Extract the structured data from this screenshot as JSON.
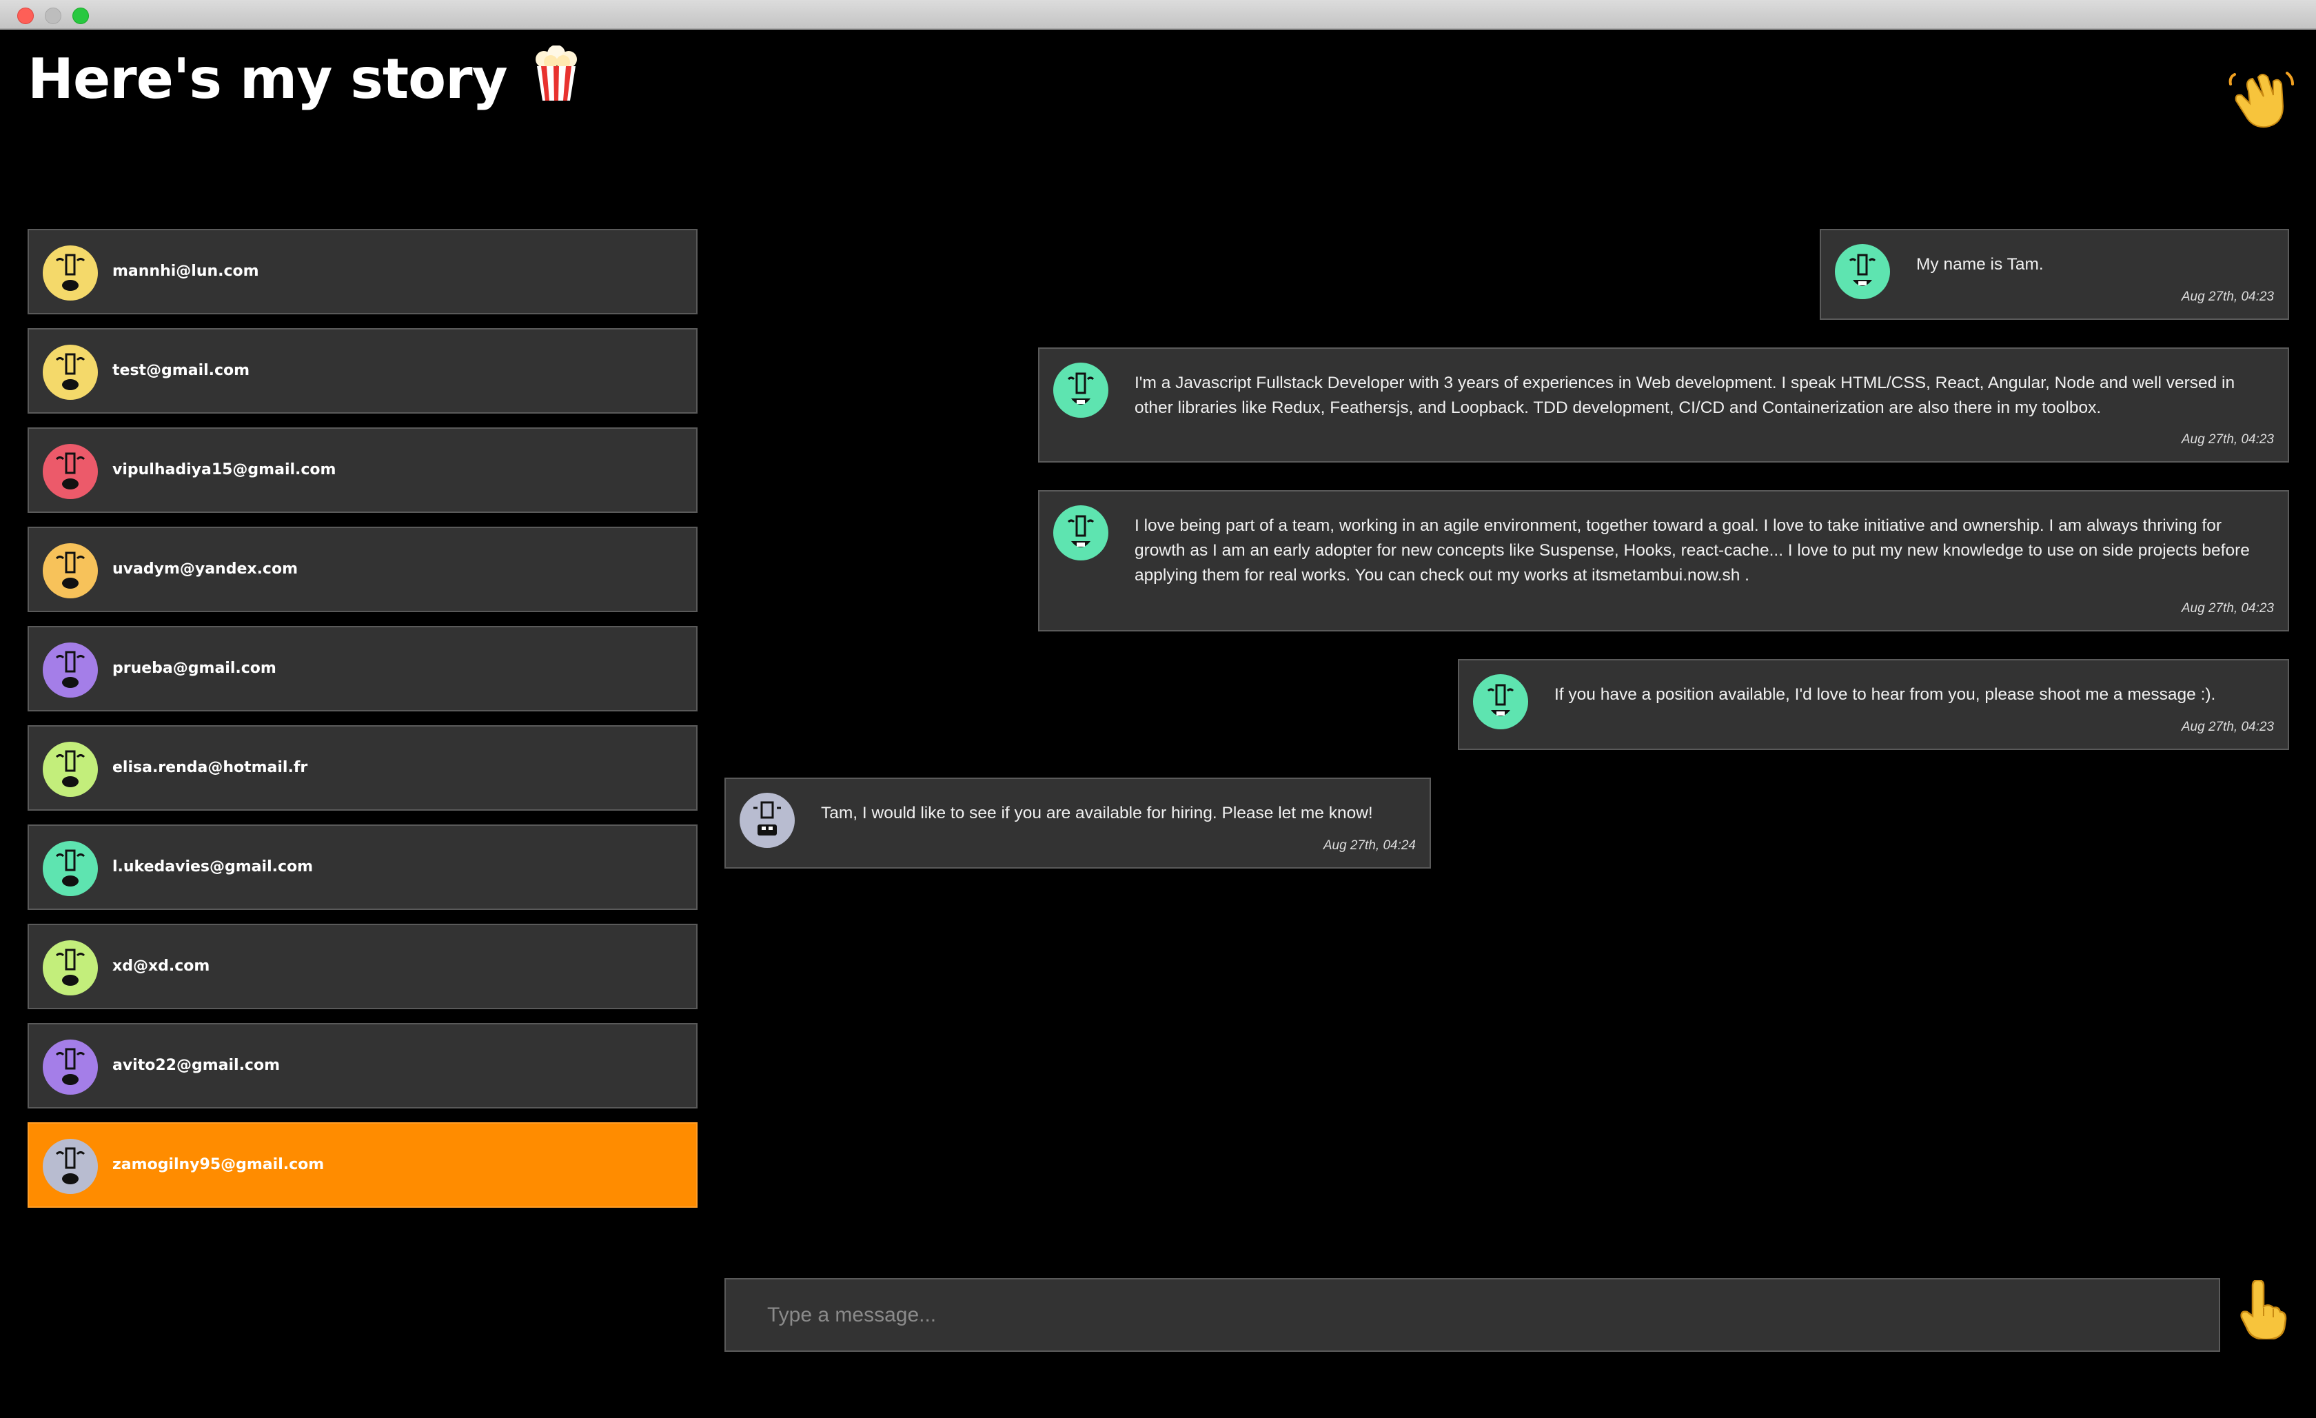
{
  "window": {
    "title": ""
  },
  "header": {
    "title": "Here's my story",
    "title_emoji": "popcorn-icon",
    "wave_button": "waving-hand-icon"
  },
  "contacts": [
    {
      "email": "mannhi@lun.com",
      "avatar_color": "#f4d96a",
      "active": false
    },
    {
      "email": "test@gmail.com",
      "avatar_color": "#f4d96a",
      "active": false
    },
    {
      "email": "vipulhadiya15@gmail.com",
      "avatar_color": "#ec5a6a",
      "active": false
    },
    {
      "email": "uvadym@yandex.com",
      "avatar_color": "#f7c25a",
      "active": false
    },
    {
      "email": "prueba@gmail.com",
      "avatar_color": "#a47ee8",
      "active": false
    },
    {
      "email": "elisa.renda@hotmail.fr",
      "avatar_color": "#c3ee7b",
      "active": false
    },
    {
      "email": "l.ukedavies@gmail.com",
      "avatar_color": "#5ee4b0",
      "active": false
    },
    {
      "email": "xd@xd.com",
      "avatar_color": "#c3ee7b",
      "active": false
    },
    {
      "email": "avito22@gmail.com",
      "avatar_color": "#a47ee8",
      "active": false
    },
    {
      "email": "zamogilny95@gmail.com",
      "avatar_color": "#b8bcd0",
      "active": true
    }
  ],
  "messages": [
    {
      "text": "My name is Tam.",
      "time": "Aug 27th, 04:23",
      "avatar_color": "#5ee4b0"
    },
    {
      "text": "I'm a Javascript Fullstack Developer with 3 years of experiences in Web development. I speak HTML/CSS, React, Angular, Node and well versed in other libraries like Redux, Feathersjs, and Loopback. TDD development, CI/CD and Containerization are also there in my toolbox.",
      "time": "Aug 27th, 04:23",
      "avatar_color": "#5ee4b0"
    },
    {
      "text": "I love being part of a team, working in an agile environment, together toward a goal. I love to take initiative and ownership. I am always thriving for growth as I am an early adopter for new concepts like Suspense, Hooks, react-cache... I love to put my new knowledge to use on side projects before applying them for real works. You can check out my works at itsmetambui.now.sh .",
      "time": "Aug 27th, 04:23",
      "avatar_color": "#5ee4b0"
    },
    {
      "text": "If you have a position available, I'd love to hear from you, please shoot me a message :).",
      "time": "Aug 27th, 04:23",
      "avatar_color": "#5ee4b0"
    },
    {
      "text": "Tam, I would like to see if you are available for hiring. Please let me know!",
      "time": "Aug 27th, 04:24",
      "avatar_color": "#b8bcd0"
    }
  ],
  "composer": {
    "placeholder": "Type a message...",
    "value": ""
  },
  "send_button": "pointing-up-hand-icon",
  "colors": {
    "background": "#000000",
    "card": "#333333",
    "accent": "#ff8c00",
    "border": "#5a5a5a"
  }
}
